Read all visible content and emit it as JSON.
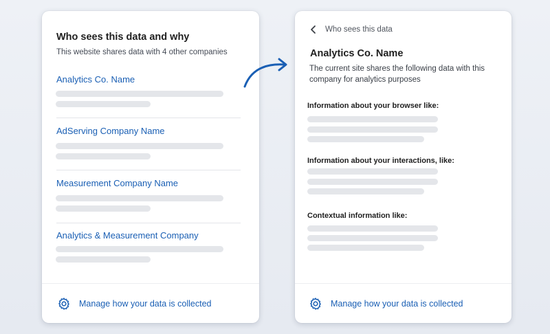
{
  "left_card": {
    "title": "Who sees this data and why",
    "subtitle": "This website shares data with 4 other companies",
    "companies": [
      {
        "name": "Analytics Co. Name"
      },
      {
        "name": "AdServing Company Name"
      },
      {
        "name": "Measurement Company Name"
      },
      {
        "name": "Analytics & Measurement  Company"
      }
    ],
    "footer_label": "Manage how your data is collected"
  },
  "right_card": {
    "back_label": "Who sees this data",
    "title": "Analytics Co. Name",
    "description": "The current site shares the following data with this company for analytics purposes",
    "sections": [
      {
        "heading": "Information about your browser like:"
      },
      {
        "heading": "Information about your interactions, like:"
      },
      {
        "heading": "Contextual information like:"
      }
    ],
    "footer_label": "Manage how your data is collected"
  },
  "icons": {
    "gear": "gear-icon",
    "back": "chevron-left-icon",
    "arrow": "curved-arrow-icon"
  },
  "colors": {
    "link": "#1a5fb4",
    "placeholder_bar": "#e4e6ea",
    "background": "#e9edf3"
  }
}
